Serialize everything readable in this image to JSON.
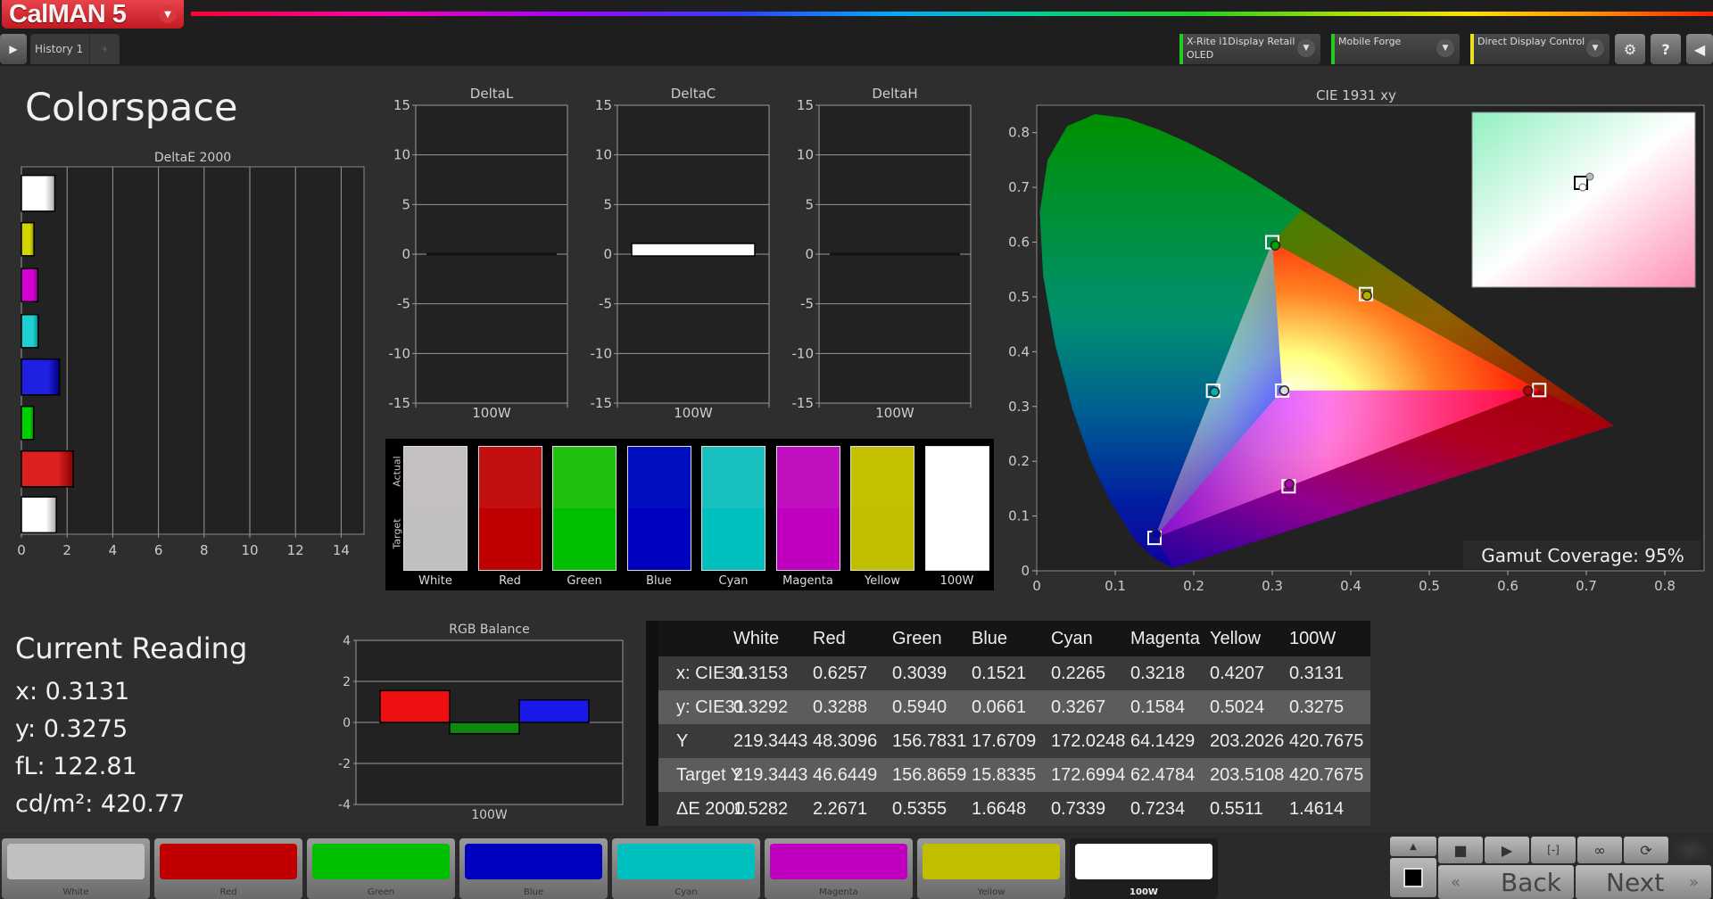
{
  "app": {
    "name": "CalMAN 5"
  },
  "tabs": [
    {
      "label": "History 1"
    }
  ],
  "devices": [
    {
      "line1": "X-Rite i1Display Retail",
      "line2": "OLED",
      "status_color": "#22cc22"
    },
    {
      "line1": "Mobile Forge",
      "line2": "",
      "status_color": "#22cc22"
    },
    {
      "line1": "Direct Display Control",
      "line2": "",
      "status_color": "#e8e020"
    }
  ],
  "toolbar_icons": [
    "gear-icon",
    "help-icon",
    "collapse-icon"
  ],
  "page": {
    "title": "Colorspace"
  },
  "colors": {
    "White": "#c0c0c0",
    "Red": "#c00000",
    "Green": "#00bf00",
    "Blue": "#0000c0",
    "Cyan": "#00bfbf",
    "Magenta": "#bf00bf",
    "Yellow": "#bfbf00",
    "100W": "#ffffff"
  },
  "chart_data": [
    {
      "type": "bar",
      "orientation": "horizontal",
      "title": "DeltaE 2000",
      "categories": [
        "White",
        "Yellow",
        "Magenta",
        "Cyan",
        "Blue",
        "Green",
        "Red",
        "White"
      ],
      "values": [
        1.4614,
        0.5511,
        0.7234,
        0.7339,
        1.6648,
        0.5355,
        2.2671,
        1.5282
      ],
      "xlim": [
        0,
        15
      ],
      "xticks": [
        "0",
        "2",
        "4",
        "6",
        "8",
        "10",
        "12",
        "14"
      ]
    },
    {
      "type": "bar",
      "title": "DeltaL",
      "categories": [
        "100W"
      ],
      "values": [
        0
      ],
      "ylim": [
        -15,
        15
      ],
      "yticks": [
        "15",
        "10",
        "5",
        "0",
        "-5",
        "-10",
        "-15"
      ]
    },
    {
      "type": "bar",
      "title": "DeltaC",
      "categories": [
        "100W"
      ],
      "values": [
        0.9
      ],
      "ylim": [
        -15,
        15
      ],
      "yticks": [
        "15",
        "10",
        "5",
        "0",
        "-5",
        "-10",
        "-15"
      ]
    },
    {
      "type": "bar",
      "title": "DeltaH",
      "categories": [
        "100W"
      ],
      "values": [
        0
      ],
      "ylim": [
        -15,
        15
      ],
      "yticks": [
        "15",
        "10",
        "5",
        "0",
        "-5",
        "-10",
        "-15"
      ]
    },
    {
      "type": "bar",
      "title": "RGB Balance",
      "categories": [
        "100W"
      ],
      "series": [
        {
          "name": "Red",
          "values": [
            1.55
          ]
        },
        {
          "name": "Green",
          "values": [
            -0.55
          ]
        },
        {
          "name": "Blue",
          "values": [
            1.1
          ]
        }
      ],
      "ylim": [
        -4,
        4
      ],
      "yticks": [
        "4",
        "2",
        "0",
        "-2",
        "-4"
      ]
    },
    {
      "type": "scatter",
      "title": "CIE 1931 xy",
      "xlim": [
        0,
        0.85
      ],
      "ylim": [
        0,
        0.85
      ],
      "xticks": [
        "0",
        "0.1",
        "0.2",
        "0.3",
        "0.4",
        "0.5",
        "0.6",
        "0.7",
        "0.8"
      ],
      "yticks": [
        "0",
        "0.1",
        "0.2",
        "0.3",
        "0.4",
        "0.5",
        "0.6",
        "0.7",
        "0.8"
      ],
      "targets": [
        {
          "name": "Red",
          "x": 0.64,
          "y": 0.33
        },
        {
          "name": "Green",
          "x": 0.3,
          "y": 0.6
        },
        {
          "name": "Blue",
          "x": 0.15,
          "y": 0.06
        },
        {
          "name": "Cyan",
          "x": 0.2246,
          "y": 0.3287
        },
        {
          "name": "Magenta",
          "x": 0.3209,
          "y": 0.1542
        },
        {
          "name": "Yellow",
          "x": 0.4193,
          "y": 0.5053
        },
        {
          "name": "White",
          "x": 0.3127,
          "y": 0.329
        }
      ],
      "measured": [
        {
          "name": "Red",
          "x": 0.6257,
          "y": 0.3288
        },
        {
          "name": "Green",
          "x": 0.3039,
          "y": 0.594
        },
        {
          "name": "Blue",
          "x": 0.1521,
          "y": 0.0661
        },
        {
          "name": "Cyan",
          "x": 0.2265,
          "y": 0.3267
        },
        {
          "name": "Magenta",
          "x": 0.3218,
          "y": 0.1584
        },
        {
          "name": "Yellow",
          "x": 0.4207,
          "y": 0.5024
        },
        {
          "name": "White",
          "x": 0.3153,
          "y": 0.3292
        }
      ],
      "annotation": "Gamut Coverage:  95%"
    }
  ],
  "swatches": {
    "labels": [
      "White",
      "Red",
      "Green",
      "Blue",
      "Cyan",
      "Magenta",
      "Yellow",
      "100W"
    ],
    "actual_label": "Actual",
    "target_label": "Target",
    "actual": [
      "#c4c0c0",
      "#c21010",
      "#20c010",
      "#0010c0",
      "#18c0c0",
      "#c010c0",
      "#c4c000",
      "#ffffff"
    ],
    "target": [
      "#c0c0c0",
      "#c00000",
      "#00bf00",
      "#0000c0",
      "#00bfbf",
      "#bf00bf",
      "#bfbf00",
      "#ffffff"
    ]
  },
  "reading": {
    "title": "Current Reading",
    "x": "x: 0.3131",
    "y": "y: 0.3275",
    "fL": "fL: 122.81",
    "cdm2": "cd/m²: 420.77"
  },
  "table": {
    "columns": [
      "",
      "White",
      "Red",
      "Green",
      "Blue",
      "Cyan",
      "Magenta",
      "Yellow",
      "100W"
    ],
    "rows": [
      [
        "x: CIE31",
        "0.3153",
        "0.6257",
        "0.3039",
        "0.1521",
        "0.2265",
        "0.3218",
        "0.4207",
        "0.3131"
      ],
      [
        "y: CIE31",
        "0.3292",
        "0.3288",
        "0.5940",
        "0.0661",
        "0.3267",
        "0.1584",
        "0.5024",
        "0.3275"
      ],
      [
        "Y",
        "219.3443",
        "48.3096",
        "156.7831",
        "17.6709",
        "172.0248",
        "64.1429",
        "203.2026",
        "420.7675"
      ],
      [
        "Target Y",
        "219.3443",
        "46.6449",
        "156.8659",
        "15.8335",
        "172.6994",
        "62.4784",
        "203.5108",
        "420.7675"
      ],
      [
        "ΔE 2000",
        "1.5282",
        "2.2671",
        "0.5355",
        "1.6648",
        "0.7339",
        "0.7234",
        "0.5511",
        "1.4614"
      ]
    ]
  },
  "patches": [
    {
      "label": "White",
      "color": "#c0c0c0"
    },
    {
      "label": "Red",
      "color": "#c00000"
    },
    {
      "label": "Green",
      "color": "#00bf00"
    },
    {
      "label": "Blue",
      "color": "#0000bf"
    },
    {
      "label": "Cyan",
      "color": "#00bfbf"
    },
    {
      "label": "Magenta",
      "color": "#bf00bf"
    },
    {
      "label": "Yellow",
      "color": "#bfbf00"
    },
    {
      "label": "100W",
      "color": "#ffffff",
      "selected": true
    }
  ],
  "nav": {
    "back": "Back",
    "next": "Next"
  }
}
